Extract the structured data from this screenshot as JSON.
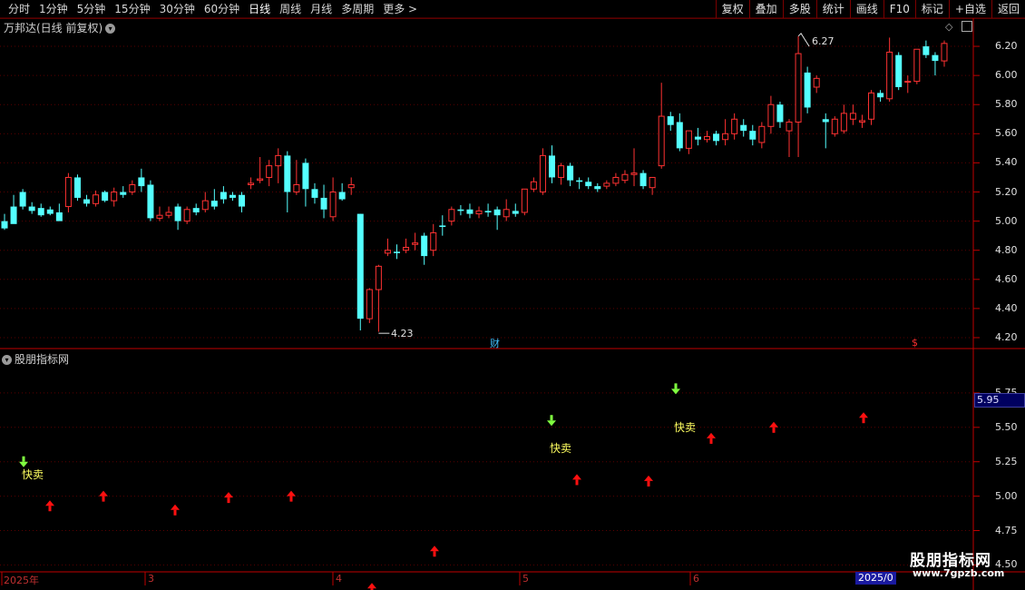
{
  "toolbar": {
    "periods": [
      "分时",
      "1分钟",
      "5分钟",
      "15分钟",
      "30分钟",
      "60分钟",
      "日线",
      "周线",
      "月线",
      "多周期",
      "更多 >"
    ],
    "active_period": "日线",
    "buttons": [
      "复权",
      "叠加",
      "多股",
      "统计",
      "画线",
      "F10",
      "标记",
      "+自选",
      "返回"
    ]
  },
  "main_panel": {
    "title": "万邦达(日线 前复权)",
    "price_axis": [
      "6.20",
      "6.00",
      "5.80",
      "5.60",
      "5.40",
      "5.20",
      "5.00",
      "4.80",
      "4.60",
      "4.40",
      "4.20"
    ],
    "high_marker": "6.27",
    "low_marker": "4.23",
    "fin_marker": "财",
    "dollar_marker": "$"
  },
  "indicator_panel": {
    "title": "股朋指标网",
    "axis": [
      "5.75",
      "5.50",
      "5.25",
      "5.00",
      "4.75",
      "4.50"
    ],
    "current_value": "5.95",
    "signal_label": "快卖"
  },
  "dates": {
    "labels": [
      "2025年",
      "3",
      "4",
      "5",
      "6"
    ],
    "highlight": "2025/0"
  },
  "watermark": {
    "main": "股朋指标网",
    "url": "www.7gpzb.com"
  },
  "colors": {
    "up": "#ff3232",
    "down": "#54ffff",
    "grid": "#5a0000",
    "signal_up_arrow": "#ff1010",
    "signal_sell_arrow": "#80ff40"
  },
  "chart_data": {
    "type": "candlestick",
    "candles": [
      [
        5.0,
        5.05,
        4.95,
        4.94
      ],
      [
        5.1,
        5.18,
        4.98,
        5.02
      ],
      [
        5.2,
        5.22,
        5.1,
        5.08
      ],
      [
        5.1,
        5.13,
        5.07,
        5.05
      ],
      [
        5.09,
        5.12,
        5.04,
        5.03
      ],
      [
        5.08,
        5.1,
        5.05,
        5.04
      ],
      [
        5.06,
        5.12,
        5.0,
        5.02
      ],
      [
        5.1,
        5.33,
        5.3,
        5.06
      ],
      [
        5.3,
        5.32,
        5.16,
        5.14
      ],
      [
        5.15,
        5.18,
        5.12,
        5.1
      ],
      [
        5.12,
        5.21,
        5.18,
        5.1
      ],
      [
        5.2,
        5.21,
        5.14,
        5.13
      ],
      [
        5.14,
        5.23,
        5.2,
        5.1
      ],
      [
        5.2,
        5.24,
        5.18,
        5.16
      ],
      [
        5.2,
        5.28,
        5.25,
        5.18
      ],
      [
        5.3,
        5.36,
        5.24,
        5.2
      ],
      [
        5.25,
        5.28,
        5.02,
        5.0
      ],
      [
        5.02,
        5.1,
        5.04,
        5.0
      ],
      [
        5.04,
        5.1,
        5.06,
        5.02
      ],
      [
        5.1,
        5.12,
        5.0,
        4.94
      ],
      [
        5.0,
        5.1,
        5.08,
        4.98
      ],
      [
        5.09,
        5.12,
        5.06,
        5.04
      ],
      [
        5.08,
        5.2,
        5.14,
        5.06
      ],
      [
        5.14,
        5.22,
        5.1,
        5.08
      ],
      [
        5.2,
        5.24,
        5.15,
        5.12
      ],
      [
        5.18,
        5.2,
        5.16,
        5.14
      ],
      [
        5.18,
        5.2,
        5.1,
        5.06
      ],
      [
        5.25,
        5.3,
        5.26,
        5.22
      ],
      [
        5.28,
        5.44,
        5.29,
        5.26
      ],
      [
        5.3,
        5.42,
        5.38,
        5.24
      ],
      [
        5.38,
        5.5,
        5.45,
        5.26
      ],
      [
        5.45,
        5.48,
        5.2,
        5.06
      ],
      [
        5.2,
        5.42,
        5.25,
        5.18
      ],
      [
        5.4,
        5.43,
        5.22,
        5.1
      ],
      [
        5.22,
        5.26,
        5.16,
        5.12
      ],
      [
        5.16,
        5.25,
        5.08,
        5.02
      ],
      [
        5.03,
        5.3,
        5.2,
        5.0
      ],
      [
        5.2,
        5.26,
        5.15,
        5.14
      ],
      [
        5.23,
        5.3,
        5.25,
        5.18
      ],
      [
        5.05,
        5.05,
        4.33,
        4.25
      ],
      [
        4.33,
        4.54,
        4.53,
        4.3
      ],
      [
        4.53,
        4.7,
        4.69,
        4.24
      ],
      [
        4.78,
        4.88,
        4.8,
        4.76
      ],
      [
        4.79,
        4.84,
        4.78,
        4.74
      ],
      [
        4.8,
        4.88,
        4.82,
        4.78
      ],
      [
        4.84,
        4.92,
        4.85,
        4.8
      ],
      [
        4.9,
        4.92,
        4.76,
        4.7
      ],
      [
        4.8,
        4.98,
        4.92,
        4.76
      ],
      [
        4.97,
        5.04,
        4.96,
        4.9
      ],
      [
        5.0,
        5.1,
        5.08,
        4.97
      ],
      [
        5.08,
        5.11,
        5.07,
        5.04
      ],
      [
        5.08,
        5.12,
        5.05,
        5.02
      ],
      [
        5.05,
        5.1,
        5.07,
        5.02
      ],
      [
        5.07,
        5.12,
        5.06,
        5.03
      ],
      [
        5.08,
        5.1,
        5.04,
        4.94
      ],
      [
        5.03,
        5.15,
        5.08,
        5.0
      ],
      [
        5.07,
        5.12,
        5.05,
        5.03
      ],
      [
        5.06,
        5.2,
        5.22,
        5.04
      ],
      [
        5.22,
        5.3,
        5.27,
        5.2
      ],
      [
        5.2,
        5.5,
        5.45,
        5.18
      ],
      [
        5.45,
        5.52,
        5.3,
        5.26
      ],
      [
        5.3,
        5.4,
        5.38,
        5.25
      ],
      [
        5.38,
        5.4,
        5.28,
        5.24
      ],
      [
        5.28,
        5.3,
        5.27,
        5.22
      ],
      [
        5.27,
        5.3,
        5.24,
        5.22
      ],
      [
        5.24,
        5.26,
        5.22,
        5.2
      ],
      [
        5.24,
        5.28,
        5.26,
        5.22
      ],
      [
        5.26,
        5.33,
        5.3,
        5.24
      ],
      [
        5.28,
        5.35,
        5.32,
        5.26
      ],
      [
        5.32,
        5.5,
        5.33,
        5.24
      ],
      [
        5.33,
        5.35,
        5.24,
        5.22
      ],
      [
        5.23,
        5.3,
        5.3,
        5.18
      ],
      [
        5.38,
        5.95,
        5.72,
        5.36
      ],
      [
        5.72,
        5.75,
        5.66,
        5.62
      ],
      [
        5.68,
        5.74,
        5.5,
        5.48
      ],
      [
        5.5,
        5.62,
        5.62,
        5.46
      ],
      [
        5.58,
        5.64,
        5.56,
        5.52
      ],
      [
        5.56,
        5.62,
        5.58,
        5.54
      ],
      [
        5.6,
        5.62,
        5.55,
        5.52
      ],
      [
        5.56,
        5.7,
        5.6,
        5.52
      ],
      [
        5.6,
        5.74,
        5.7,
        5.56
      ],
      [
        5.66,
        5.7,
        5.62,
        5.58
      ],
      [
        5.62,
        5.66,
        5.56,
        5.52
      ],
      [
        5.54,
        5.68,
        5.65,
        5.5
      ],
      [
        5.65,
        5.86,
        5.8,
        5.6
      ],
      [
        5.8,
        5.82,
        5.68,
        5.64
      ],
      [
        5.62,
        5.7,
        5.68,
        5.44
      ],
      [
        5.68,
        6.27,
        6.15,
        5.44
      ],
      [
        6.02,
        6.06,
        5.78,
        5.74
      ],
      [
        5.92,
        6.0,
        5.98,
        5.88
      ],
      [
        5.7,
        5.74,
        5.68,
        5.5
      ],
      [
        5.6,
        5.72,
        5.7,
        5.58
      ],
      [
        5.62,
        5.8,
        5.74,
        5.6
      ],
      [
        5.7,
        5.8,
        5.74,
        5.66
      ],
      [
        5.68,
        5.73,
        5.69,
        5.64
      ],
      [
        5.7,
        5.9,
        5.88,
        5.66
      ],
      [
        5.88,
        5.9,
        5.85,
        5.82
      ],
      [
        5.84,
        6.26,
        6.16,
        5.82
      ],
      [
        6.14,
        6.16,
        5.92,
        5.9
      ],
      [
        5.96,
        6.0,
        5.96,
        5.88
      ],
      [
        5.96,
        6.18,
        6.18,
        5.94
      ],
      [
        6.2,
        6.24,
        6.14,
        6.12
      ],
      [
        6.14,
        6.16,
        6.1,
        6.0
      ],
      [
        6.1,
        6.24,
        6.22,
        6.06
      ]
    ],
    "indicator": {
      "up_arrows": [
        [
          55,
          4.93
        ],
        [
          114,
          5.0
        ],
        [
          193,
          4.9
        ],
        [
          252,
          4.99
        ],
        [
          321,
          5.0
        ],
        [
          410,
          4.33
        ],
        [
          479,
          4.6
        ],
        [
          636,
          5.12
        ],
        [
          715,
          5.11
        ],
        [
          784,
          5.42
        ],
        [
          853,
          5.5
        ],
        [
          952,
          5.57
        ]
      ],
      "sell_signals": [
        [
          26,
          5.25
        ],
        [
          608,
          5.55
        ],
        [
          745,
          5.78
        ]
      ]
    },
    "main_ylim": [
      4.15,
      6.3
    ],
    "indicator_ylim": [
      4.45,
      6.0
    ]
  }
}
